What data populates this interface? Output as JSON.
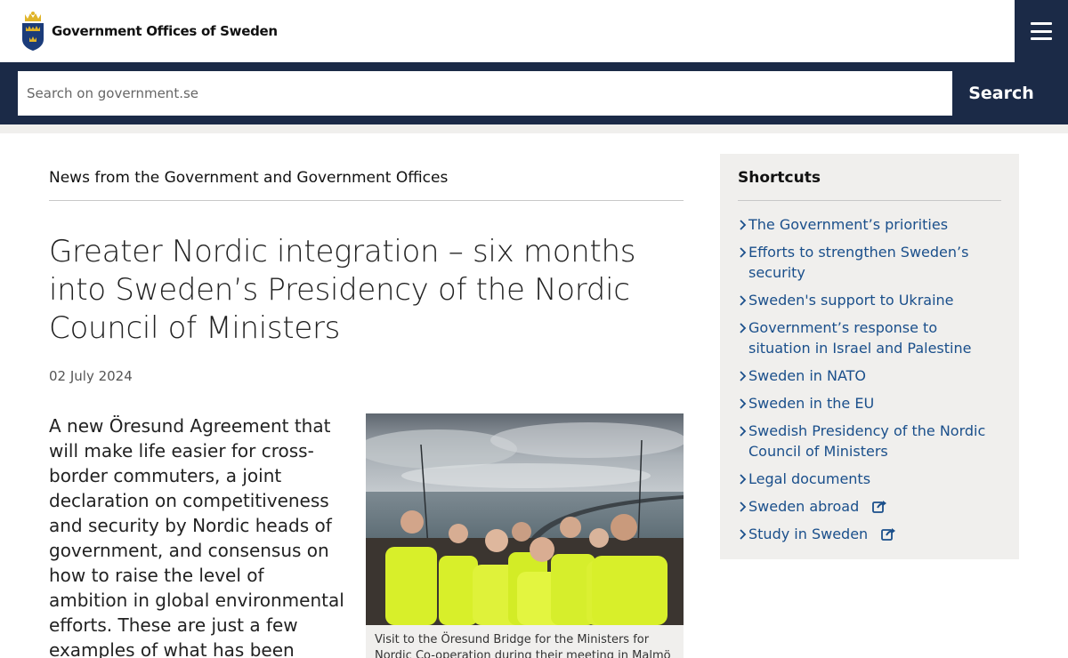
{
  "header": {
    "site_name": "Government Offices of Sweden",
    "menu_icon": "hamburger-menu-icon"
  },
  "search": {
    "placeholder": "Search on government.se",
    "value": "",
    "button_label": "Search"
  },
  "article": {
    "kicker": "News from the Government and Government Offices",
    "title": "Greater Nordic integration – six months into Sweden’s Presidency of the Nordic Council of Ministers",
    "date": "02 July 2024",
    "lead": "A new Öresund Agreement that will make life easier for cross-border commuters, a joint declaration on competitiveness and security by Nordic heads of government, and consensus on how to raise the level of ambition in global environmental efforts. These are just a few examples of what has been achieved during the",
    "image_caption": "Visit to the Öresund Bridge for the Ministers for Nordic Co-operation during their meeting in Malmö"
  },
  "sidebar": {
    "title": "Shortcuts",
    "items": [
      {
        "label": "The Government’s priorities",
        "external": false
      },
      {
        "label": "Efforts to strengthen Sweden’s security",
        "external": false
      },
      {
        "label": "Sweden's support to Ukraine",
        "external": false
      },
      {
        "label": "Government’s response to situation in Israel and Palestine",
        "external": false
      },
      {
        "label": "Sweden in NATO",
        "external": false
      },
      {
        "label": "Sweden in the EU",
        "external": false
      },
      {
        "label": "Swedish Presidency of the Nordic Council of Ministers",
        "external": false
      },
      {
        "label": "Legal documents",
        "external": false
      },
      {
        "label": "Sweden abroad",
        "external": true
      },
      {
        "label": "Study in Sweden",
        "external": true
      }
    ]
  },
  "colors": {
    "navy": "#1b2a47",
    "link_blue": "#1a4f8b",
    "panel_gray": "#f0efed"
  }
}
